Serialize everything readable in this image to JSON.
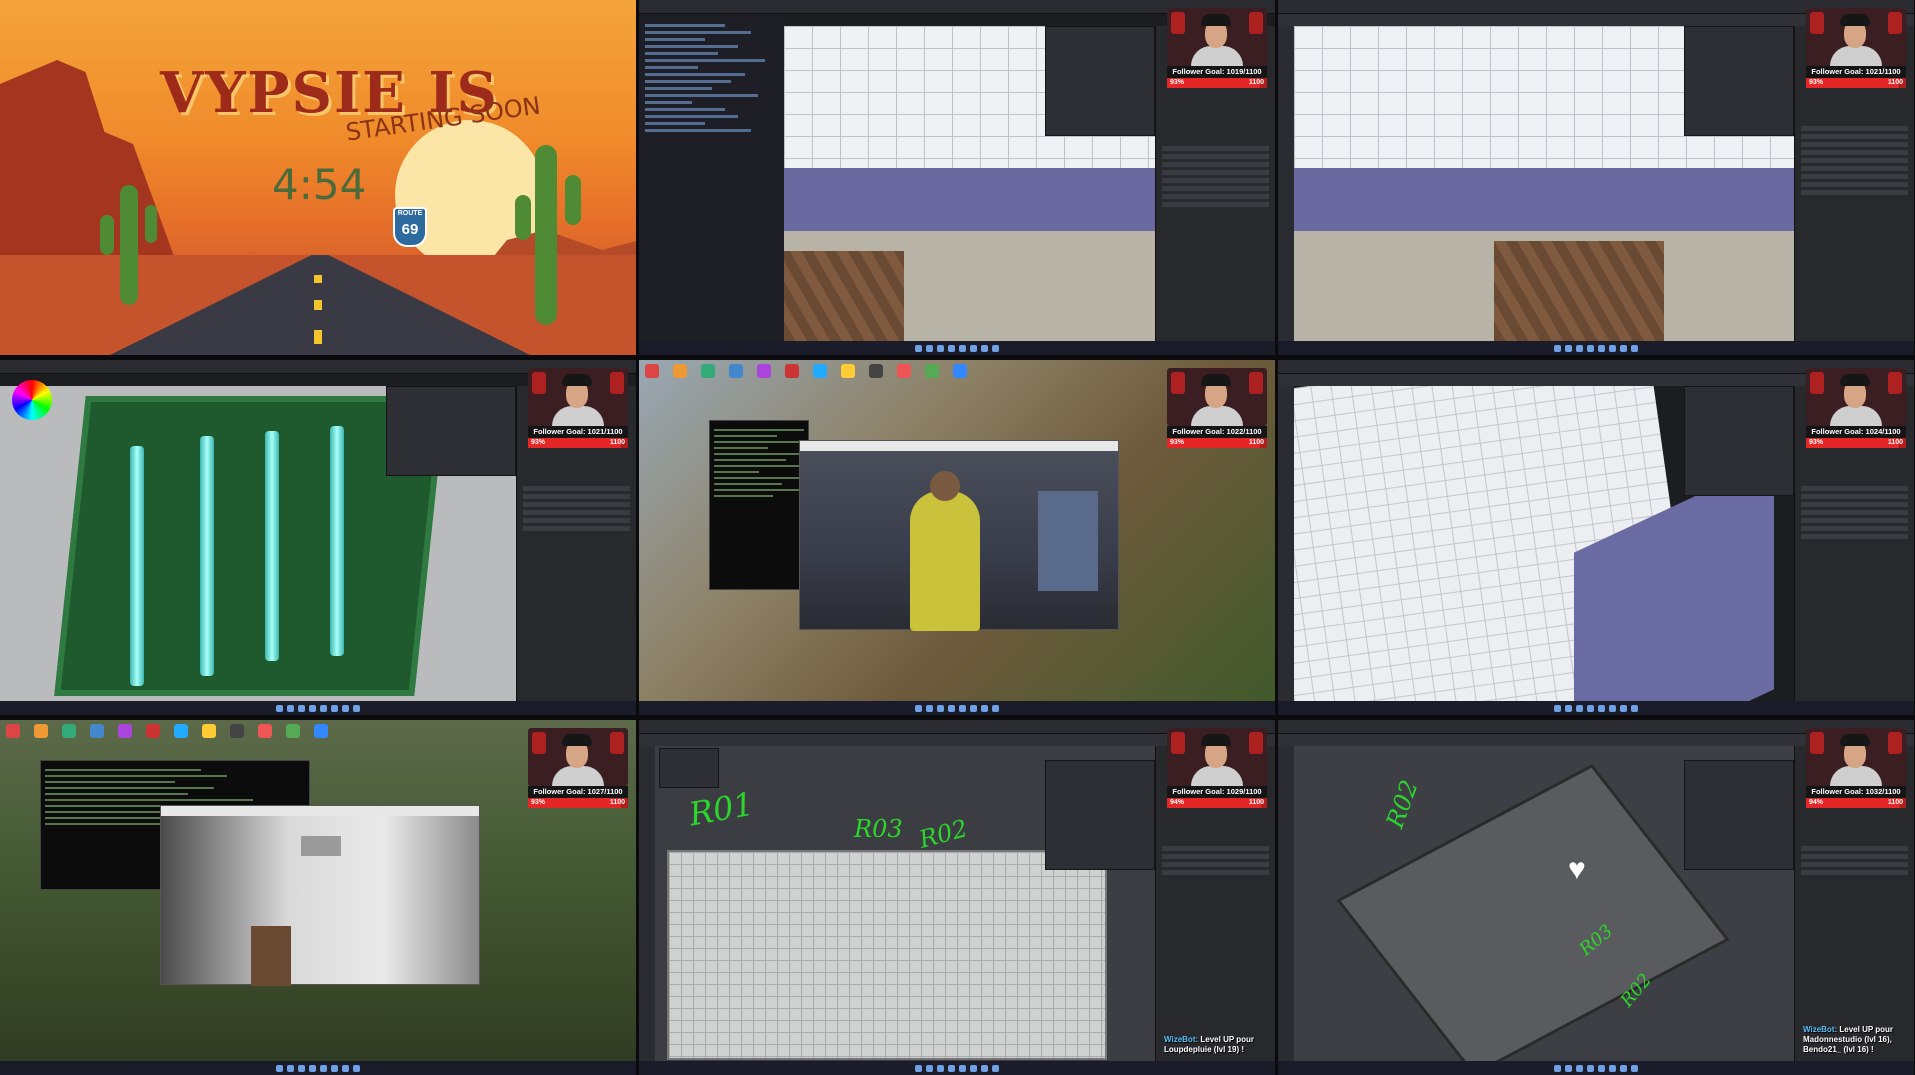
{
  "starting_soon": {
    "title": "VYPSIE IS",
    "subtitle": "STARTING SOON",
    "countdown": "4:54",
    "route_label": "ROUTE",
    "route_number": "69"
  },
  "overlays": [
    {
      "goal": "Follower Goal: 1019/1100",
      "percent": "93%",
      "max": "1100",
      "fill": 0.93
    },
    {
      "goal": "Follower Goal: 1021/1100",
      "percent": "93%",
      "max": "1100",
      "fill": 0.93
    },
    {
      "goal": "Follower Goal: 1021/1100",
      "percent": "93%",
      "max": "1100",
      "fill": 0.93
    },
    {
      "goal": "Follower Goal: 1022/1100",
      "percent": "93%",
      "max": "1100",
      "fill": 0.93
    },
    {
      "goal": "Follower Goal: 1024/1100",
      "percent": "93%",
      "max": "1100",
      "fill": 0.93
    },
    {
      "goal": "Follower Goal: 1027/1100",
      "percent": "93%",
      "max": "1100",
      "fill": 0.93
    },
    {
      "goal": "Follower Goal: 1029/1100",
      "percent": "94%",
      "max": "1100",
      "fill": 0.94
    },
    {
      "goal": "Follower Goal: 1032/1100",
      "percent": "94%",
      "max": "1100",
      "fill": 0.94
    }
  ],
  "chat": [
    {
      "bot": "WizeBot:",
      "message": "Level UP pour Loupdepluie (lvl 19) !"
    },
    {
      "bot": "WizeBot:",
      "message": "Level UP pour Madonnestudio (lvl 16), Bendo21_ (lvl 16) !"
    }
  ],
  "sketch_labels": {
    "tile8": [
      "R01",
      "R03",
      "R02"
    ],
    "tile9": [
      "R02",
      "R03",
      "R02"
    ]
  },
  "colors": {
    "accent_red": "#e52626",
    "blender_bg": "#2a2b30",
    "annotation_green": "#2bd52b"
  }
}
